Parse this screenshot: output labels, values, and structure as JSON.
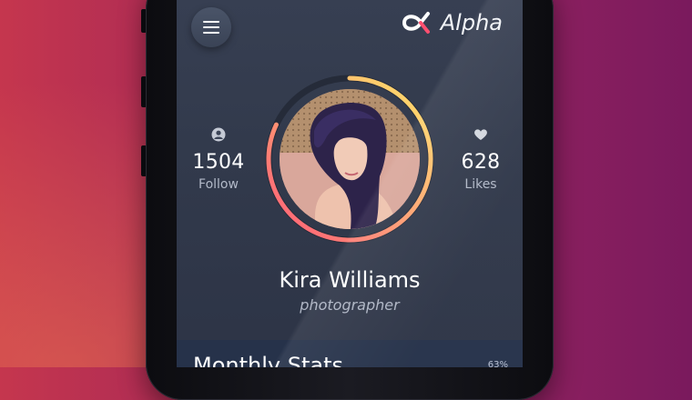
{
  "app": {
    "brand_name": "Alpha"
  },
  "profile": {
    "name": "Kira Williams",
    "role": "photographer",
    "stats": {
      "follow": {
        "value": "1504",
        "label": "Follow"
      },
      "likes": {
        "value": "628",
        "label": "Likes"
      }
    },
    "ring_progress_fraction": 0.82
  },
  "panel": {
    "title": "Monthly Stats",
    "percent": "63%"
  },
  "colors": {
    "ring_start": "#ff5a78",
    "ring_end": "#ffe66a",
    "ring_track": "#252b39",
    "screen_bg": "#343c4f",
    "panel_bg": "#26324a"
  },
  "icons": {
    "menu": "hamburger-icon",
    "brand": "alpha-logo-icon",
    "follow": "user-icon",
    "likes": "heart-icon"
  }
}
